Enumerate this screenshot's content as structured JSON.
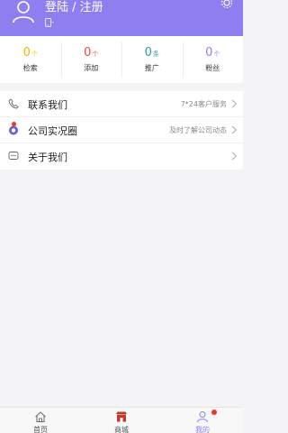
{
  "header": {
    "login_label": "登陆 / 注册",
    "phone_value": "-",
    "accent_color": "#8d7ff0"
  },
  "stats": [
    {
      "value": "0",
      "unit": "个",
      "label": "检索",
      "color": "#f2b705"
    },
    {
      "value": "0",
      "unit": "个",
      "label": "添加",
      "color": "#e34b4b"
    },
    {
      "value": "0",
      "unit": "条",
      "label": "推广",
      "color": "#2aa198"
    },
    {
      "value": "0",
      "unit": "个",
      "label": "粉丝",
      "color": "#8d7ff0"
    }
  ],
  "menu": [
    {
      "title": "联系我们",
      "sub": "7*24客户服务",
      "icon": "phone-icon"
    },
    {
      "title": "公司实况圈",
      "sub": "及时了解公司动态",
      "icon": "camera-icon"
    },
    {
      "title": "关于我们",
      "sub": "",
      "icon": "chat-bubble-icon"
    }
  ],
  "tabs": [
    {
      "label": "首页",
      "icon": "home-icon"
    },
    {
      "label": "商城",
      "icon": "shop-icon"
    },
    {
      "label": "我的",
      "icon": "user-icon"
    }
  ]
}
